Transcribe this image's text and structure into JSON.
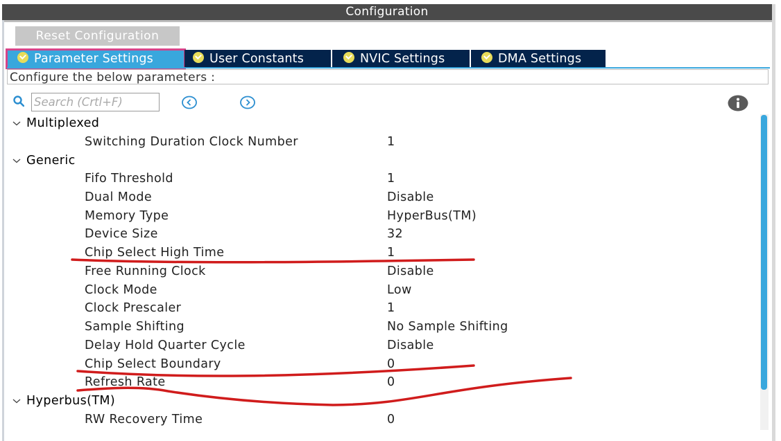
{
  "window": {
    "title": "Configuration"
  },
  "toolbar": {
    "reset_label": "Reset Configuration"
  },
  "tabs": [
    {
      "label": "Parameter Settings",
      "active": true
    },
    {
      "label": "User Constants",
      "active": false
    },
    {
      "label": "NVIC Settings",
      "active": false
    },
    {
      "label": "DMA Settings",
      "active": false
    }
  ],
  "description": "Configure the below parameters :",
  "search": {
    "placeholder": "Search (Crtl+F)"
  },
  "icons": {
    "search": "search-icon",
    "prev": "chevron-left-circle-icon",
    "next": "chevron-right-circle-icon",
    "info": "info-icon",
    "tab_check": "check-circle-icon",
    "group_toggle": "chevron-down-icon"
  },
  "groups": [
    {
      "label": "Multiplexed",
      "params": [
        {
          "name": "Switching Duration Clock Number",
          "value": "1"
        }
      ]
    },
    {
      "label": "Generic",
      "params": [
        {
          "name": "Fifo Threshold",
          "value": "1"
        },
        {
          "name": "Dual Mode",
          "value": "Disable"
        },
        {
          "name": "Memory Type",
          "value": "HyperBus(TM)"
        },
        {
          "name": "Device Size",
          "value": "32"
        },
        {
          "name": "Chip Select High Time",
          "value": "1"
        },
        {
          "name": "Free Running Clock",
          "value": "Disable"
        },
        {
          "name": "Clock Mode",
          "value": "Low"
        },
        {
          "name": "Clock Prescaler",
          "value": "1"
        },
        {
          "name": "Sample Shifting",
          "value": "No Sample Shifting"
        },
        {
          "name": "Delay Hold Quarter Cycle",
          "value": "Disable"
        },
        {
          "name": "Chip Select Boundary",
          "value": "0"
        },
        {
          "name": "Refresh Rate",
          "value": "0"
        }
      ]
    },
    {
      "label": "Hyperbus(TM)",
      "params": [
        {
          "name": "RW Recovery Time",
          "value": "0"
        }
      ]
    }
  ],
  "colors": {
    "title_bar": "#4a4a4a",
    "tab_bg": "#03234b",
    "tab_active": "#39a7dd",
    "tab_highlight": "#d6448a",
    "tab_icon": "#e7dc5a",
    "scrollbar": "#39a7dd",
    "annotation": "#d01c1c"
  }
}
